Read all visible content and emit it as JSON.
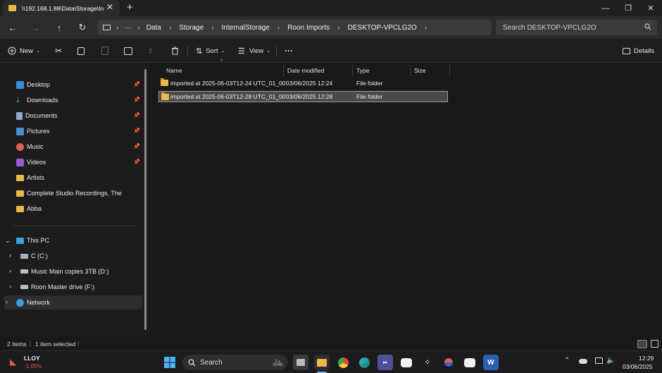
{
  "window": {
    "tab_title": "\\\\192.168.1.88\\Data\\Storage\\In"
  },
  "breadcrumb": [
    "Data",
    "Storage",
    "InternalStorage",
    "Roon Imports",
    "DESKTOP-VPCLG2O"
  ],
  "search": {
    "placeholder": "Search DESKTOP-VPCLG2O"
  },
  "toolbar": {
    "new_label": "New",
    "sort_label": "Sort",
    "view_label": "View",
    "details_label": "Details"
  },
  "sidebar": {
    "quick_access": [
      {
        "label": "Desktop",
        "icon": "desktop-icon",
        "pinned": true
      },
      {
        "label": "Downloads",
        "icon": "download-icon",
        "pinned": true
      },
      {
        "label": "Documents",
        "icon": "documents-icon",
        "pinned": true
      },
      {
        "label": "Pictures",
        "icon": "pictures-icon",
        "pinned": true
      },
      {
        "label": "Music",
        "icon": "music-icon",
        "pinned": true
      },
      {
        "label": "Videos",
        "icon": "videos-icon",
        "pinned": true
      },
      {
        "label": "Artists",
        "icon": "folder-icon",
        "pinned": false
      },
      {
        "label": "Complete Studio Recordings, The",
        "icon": "folder-icon",
        "pinned": false
      },
      {
        "label": "Abba",
        "icon": "folder-icon",
        "pinned": false
      }
    ],
    "this_pc": "This PC",
    "drives": [
      {
        "label": "C (C:)"
      },
      {
        "label": "Music Main copies 3TB (D:)"
      },
      {
        "label": "Roon Master drive (F:)"
      }
    ],
    "network": "Network"
  },
  "columns": {
    "name": "Name",
    "date": "Date modified",
    "type": "Type",
    "size": "Size"
  },
  "files": [
    {
      "name": "imported at 2025-06-03T12-24 UTC_01_00",
      "date": "03/06/2025 12:24",
      "type": "File folder",
      "size": ""
    },
    {
      "name": "imported at 2025-06-03T12-28 UTC_01_00",
      "date": "03/06/2025 12:28",
      "type": "File folder",
      "size": ""
    }
  ],
  "status": {
    "items": "2 items",
    "selected": "1 item selected"
  },
  "taskbar": {
    "stock_symbol": "LLOY",
    "stock_change": "-1.05%",
    "search_label": "Search",
    "time": "12:29",
    "date": "03/06/2025"
  },
  "colors": {
    "accent": "#e9b949",
    "stock_negative": "#e05a4f",
    "network_icon": "#3aa0e6"
  }
}
